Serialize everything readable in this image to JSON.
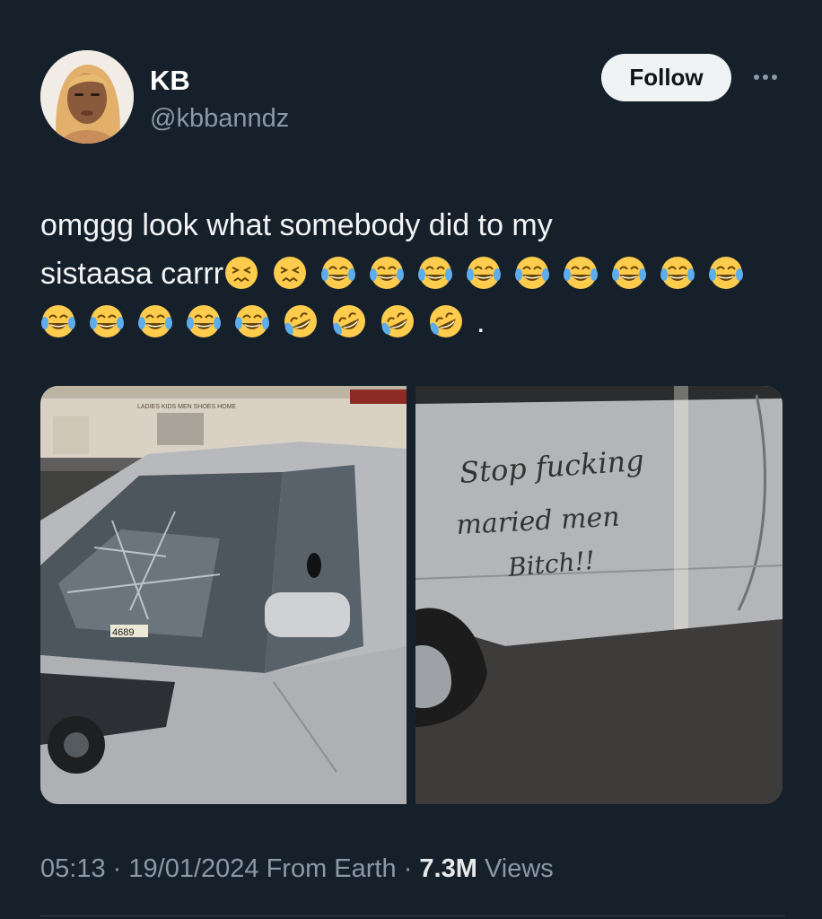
{
  "author": {
    "display_name": "KB",
    "handle": "@kbbanndz"
  },
  "actions": {
    "follow_label": "Follow",
    "more_icon": "more-horizontal-icon"
  },
  "tweet": {
    "text_line1": "omggg look what somebody did to my",
    "text_line2_prefix": "sistaasa carrr",
    "trailing_period": ".",
    "emoji_sequence": [
      "confounded",
      "confounded",
      "joy",
      "joy",
      "joy",
      "joy",
      "joy",
      "joy",
      "joy",
      "joy",
      "joy",
      "joy",
      "joy",
      "joy",
      "joy",
      "joy",
      "rofl",
      "rofl",
      "rofl",
      "rofl"
    ]
  },
  "media": {
    "photo_left": {
      "storefront_sign": "LADIES KIDS MEN SHOES HOME",
      "plate_fragment": "4689"
    },
    "photo_right": {
      "graffiti_line1": "Stop fucking",
      "graffiti_line2": "maried men",
      "graffiti_line3": "Bitch!!"
    }
  },
  "meta": {
    "time": "05:13",
    "date": "19/01/2024",
    "source": "From Earth",
    "views_count": "7.3M",
    "views_label": "Views",
    "separator": "·"
  },
  "colors": {
    "background": "#15202b",
    "follow_button": "#eff3f4",
    "secondary_text": "#8b98a5"
  }
}
